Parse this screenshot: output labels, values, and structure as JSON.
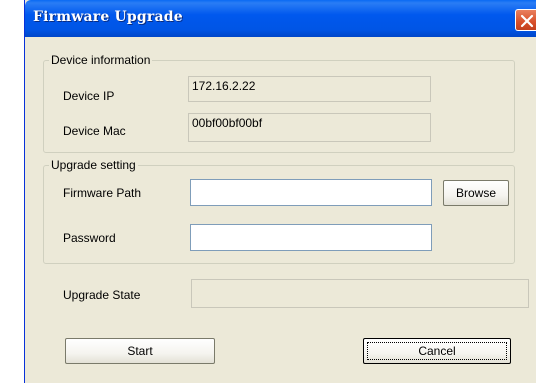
{
  "window": {
    "title": "Firmware Upgrade"
  },
  "device_info": {
    "group_title": "Device information",
    "ip_label": "Device IP",
    "ip_value": "172.16.2.22",
    "mac_label": "Device Mac",
    "mac_value": "00bf00bf00bf"
  },
  "upgrade_setting": {
    "group_title": "Upgrade setting",
    "firmware_path_label": "Firmware Path",
    "firmware_path_value": "",
    "browse_label": "Browse",
    "password_label": "Password",
    "password_value": ""
  },
  "upgrade_state": {
    "label": "Upgrade State",
    "value": ""
  },
  "buttons": {
    "start_label": "Start",
    "cancel_label": "Cancel"
  },
  "colors": {
    "window_bg": "#ECE9D8",
    "titlebar": "#0055E5",
    "close_button": "#D8502B"
  },
  "icons": {
    "close": "close-icon"
  }
}
